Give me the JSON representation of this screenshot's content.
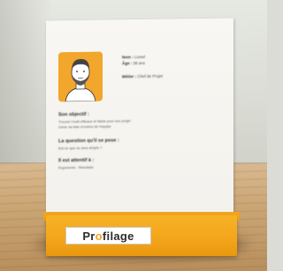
{
  "profile": {
    "fields": [
      {
        "label": "Nom :",
        "value": "Lionel"
      },
      {
        "label": "Âge :",
        "value": "38 ans"
      },
      {
        "label": "Métier :",
        "value": "Chef de Projet"
      }
    ],
    "sections": [
      {
        "title": "Son objectif :",
        "lines": [
          "Trouver l'outil efficace et fiable pour son projet",
          "Gérer sa liste d'ordres de l'équipe"
        ]
      },
      {
        "title": "La question qu'il se pose :",
        "lines": [
          "Est-ce que ce sera simple ?"
        ]
      },
      {
        "title": "Il est attentif à :",
        "lines": [
          "Ergonomie - Résultats"
        ]
      }
    ]
  },
  "brand": {
    "part1": "Pr",
    "highlight": "o",
    "part2": "filage"
  },
  "colors": {
    "accent": "#f3a51a",
    "card": "#f6f5f1",
    "table": "#c9a473"
  }
}
